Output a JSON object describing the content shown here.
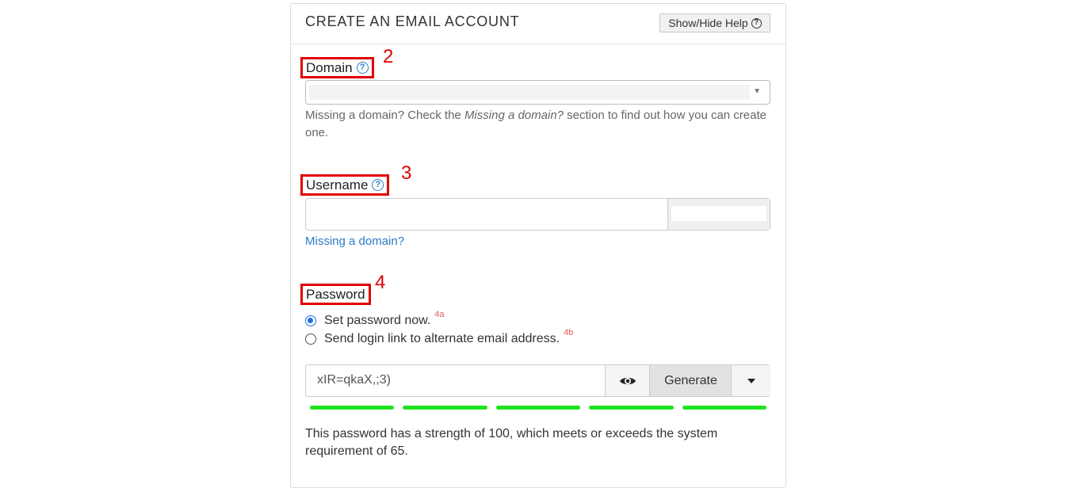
{
  "header": {
    "title": "CREATE AN EMAIL ACCOUNT",
    "help_toggle_label": "Show/Hide Help"
  },
  "domain": {
    "label": "Domain",
    "step": "2",
    "selected_value": "",
    "help_prefix": "Missing a domain? Check the ",
    "help_italic": "Missing a domain?",
    "help_suffix": " section to find out how you can create one."
  },
  "username": {
    "label": "Username",
    "step": "3",
    "value": "",
    "domain_suffix": "",
    "link": "Missing a domain?"
  },
  "password": {
    "label": "Password",
    "step": "4",
    "options": [
      {
        "label": "Set password now.",
        "tag": "4a",
        "checked": true
      },
      {
        "label": "Send login link to alternate email address.",
        "tag": "4b",
        "checked": false
      }
    ],
    "value": "xIR=qkaX,;3)",
    "generate_label": "Generate",
    "strength_segments": 5,
    "strength_score": 100,
    "strength_color": "#1fe31f",
    "strength_text": "This password has a strength of 100, which meets or exceeds the system requirement of 65."
  },
  "colors": {
    "annotation_red": "#e00000",
    "link_blue": "#2a7cc4",
    "radio_blue": "#1a73e8"
  }
}
